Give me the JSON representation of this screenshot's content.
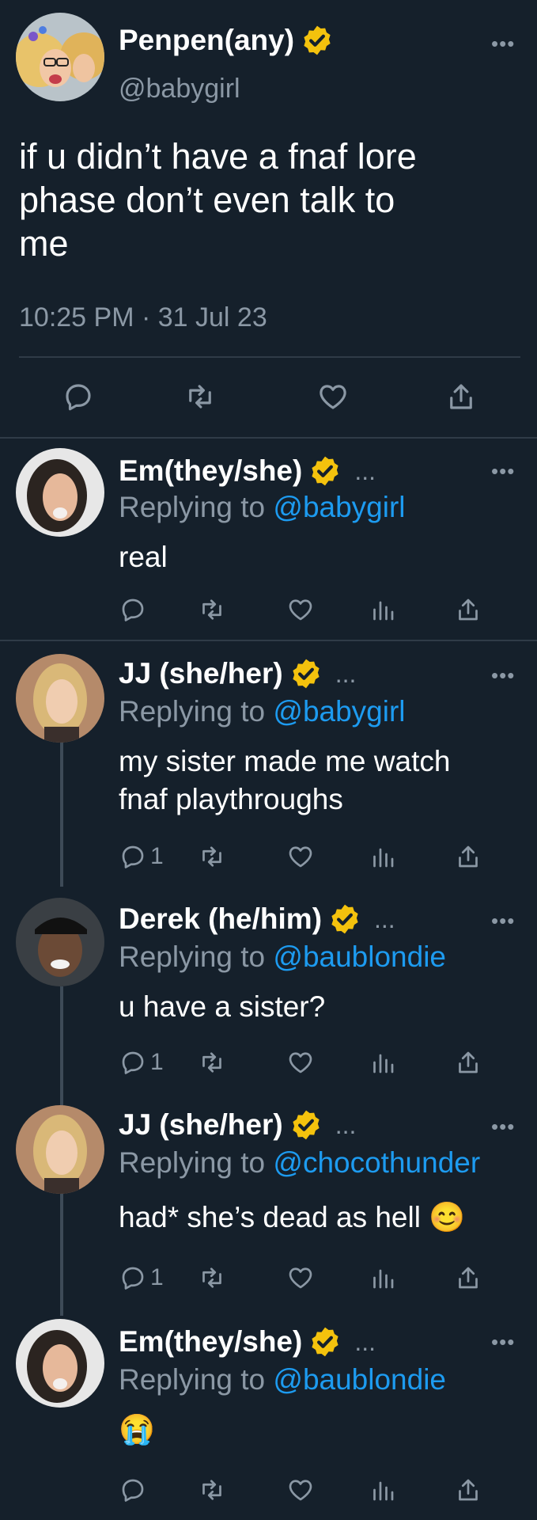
{
  "main_tweet": {
    "display_name": "Penpen(any)",
    "handle": "@babygirl",
    "more": "•••",
    "text_lines": [
      "if u didn’t have a fnaf lore",
      "phase don’t even talk to",
      "me"
    ],
    "timestamp": "10:25 PM · 31 Jul 23"
  },
  "replies": [
    {
      "display_name": "Em(they/she)",
      "trailing": "...",
      "replying_label": "Replying to",
      "mention": "@babygirl",
      "text_lines": [
        "real"
      ],
      "reply_count": "",
      "more": "•••"
    },
    {
      "display_name": "JJ (she/her)",
      "trailing": "...",
      "replying_label": "Replying to",
      "mention": "@babygirl",
      "text_lines": [
        "my sister made me watch",
        "fnaf playthroughs"
      ],
      "reply_count": "1",
      "more": "•••"
    },
    {
      "display_name": "Derek (he/him)",
      "trailing": "...",
      "replying_label": "Replying to",
      "mention": "@baublondie",
      "text_lines": [
        "u have a sister?"
      ],
      "reply_count": "1",
      "more": "•••"
    },
    {
      "display_name": "JJ (she/her)",
      "trailing": "...",
      "replying_label": "Replying to",
      "mention": "@chocothunder",
      "text_lines": [
        "had* she’s dead as hell 😊"
      ],
      "reply_count": "1",
      "more": "•••"
    },
    {
      "display_name": "Em(they/she)",
      "trailing": "...",
      "replying_label": "Replying to",
      "mention": "@baublondie",
      "text_lines": [
        "😭"
      ],
      "reply_count": "",
      "more": "•••"
    }
  ],
  "icons": {
    "reply": "reply-icon",
    "retweet": "retweet-icon",
    "like": "heart-icon",
    "views": "views-icon",
    "share": "share-icon",
    "verified": "verified-badge-icon"
  },
  "colors": {
    "background": "#15202b",
    "text": "#ffffff",
    "secondary": "#8b98a5",
    "link": "#1d9bf0",
    "badge": "#f4c20d",
    "divider": "#2f3b47"
  }
}
